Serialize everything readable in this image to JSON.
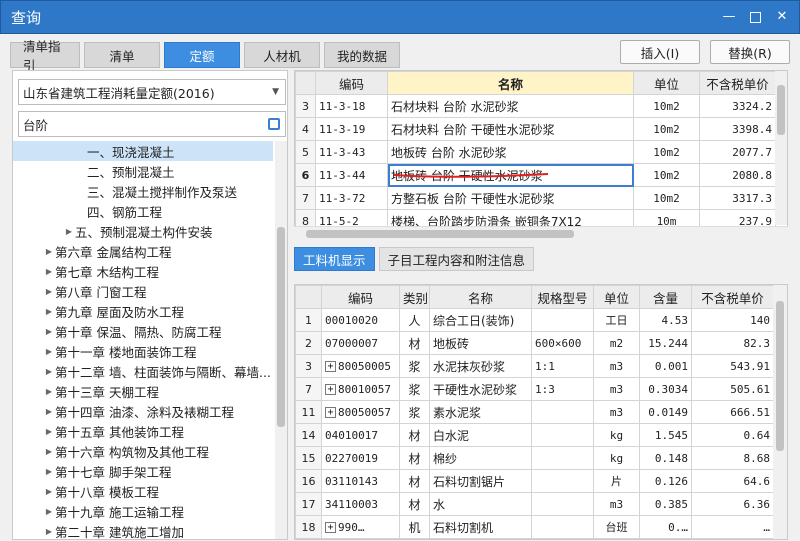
{
  "window": {
    "title": "查询"
  },
  "tabs": [
    "清单指引",
    "清单",
    "定额",
    "人材机",
    "我的数据"
  ],
  "buttons": {
    "insert": "插入(I)",
    "replace": "替换(R)"
  },
  "left": {
    "dropdown": "山东省建筑工程消耗量定额(2016)",
    "search": "台阶",
    "tree": [
      {
        "label": "一、现浇混凝土",
        "indent": 3,
        "selected": true
      },
      {
        "label": "二、预制混凝土",
        "indent": 3
      },
      {
        "label": "三、混凝土搅拌制作及泵送",
        "indent": 3
      },
      {
        "label": "四、钢筋工程",
        "indent": 3
      },
      {
        "label": "五、预制混凝土构件安装",
        "indent": 2,
        "arrow": true
      },
      {
        "label": "第六章 金属结构工程",
        "indent": 1,
        "arrow": true
      },
      {
        "label": "第七章 木结构工程",
        "indent": 1,
        "arrow": true
      },
      {
        "label": "第八章 门窗工程",
        "indent": 1,
        "arrow": true
      },
      {
        "label": "第九章 屋面及防水工程",
        "indent": 1,
        "arrow": true
      },
      {
        "label": "第十章 保温、隔热、防腐工程",
        "indent": 1,
        "arrow": true
      },
      {
        "label": "第十一章 楼地面装饰工程",
        "indent": 1,
        "arrow": true
      },
      {
        "label": "第十二章 墙、柱面装饰与隔断、幕墙...",
        "indent": 1,
        "arrow": true
      },
      {
        "label": "第十三章 天棚工程",
        "indent": 1,
        "arrow": true
      },
      {
        "label": "第十四章 油漆、涂料及裱糊工程",
        "indent": 1,
        "arrow": true
      },
      {
        "label": "第十五章 其他装饰工程",
        "indent": 1,
        "arrow": true
      },
      {
        "label": "第十六章 构筑物及其他工程",
        "indent": 1,
        "arrow": true
      },
      {
        "label": "第十七章 脚手架工程",
        "indent": 1,
        "arrow": true
      },
      {
        "label": "第十八章 模板工程",
        "indent": 1,
        "arrow": true
      },
      {
        "label": "第十九章 施工运输工程",
        "indent": 1,
        "arrow": true
      },
      {
        "label": "第二十章 建筑施工增加",
        "indent": 1,
        "arrow": true
      }
    ]
  },
  "topgrid": {
    "headers": [
      "",
      "编码",
      "名称",
      "单位",
      "不含税单价"
    ],
    "rows": [
      {
        "n": "3",
        "code": "11-3-18",
        "name": "石材块料 台阶 水泥砂浆",
        "unit": "10m2",
        "price": "3324.2"
      },
      {
        "n": "4",
        "code": "11-3-19",
        "name": "石材块料 台阶 干硬性水泥砂浆",
        "unit": "10m2",
        "price": "3398.4"
      },
      {
        "n": "5",
        "code": "11-3-43",
        "name": "地板砖 台阶 水泥砂浆",
        "unit": "10m2",
        "price": "2077.7"
      },
      {
        "n": "6",
        "code": "11-3-44",
        "name": "地板砖 台阶 干硬性水泥砂浆",
        "unit": "10m2",
        "price": "2080.8",
        "current": true
      },
      {
        "n": "7",
        "code": "11-3-72",
        "name": "方整石板 台阶 干硬性水泥砂浆",
        "unit": "10m2",
        "price": "3317.3"
      },
      {
        "n": "8",
        "code": "11-5-2",
        "name": "楼梯、台阶踏步防滑条 嵌铜条7X12",
        "unit": "10m",
        "price": "237.9"
      }
    ]
  },
  "subtabs": [
    "工料机显示",
    "子目工程内容和附注信息"
  ],
  "botgrid": {
    "headers": [
      "",
      "编码",
      "类别",
      "名称",
      "规格型号",
      "单位",
      "含量",
      "不含税单价"
    ],
    "rows": [
      {
        "n": "1",
        "code": "00010020",
        "cat": "人",
        "name": "综合工日(装饰)",
        "spec": "",
        "unit": "工日",
        "qty": "4.53",
        "price": "140"
      },
      {
        "n": "2",
        "code": "07000007",
        "cat": "材",
        "name": "地板砖",
        "spec": "600×600",
        "unit": "m2",
        "qty": "15.244",
        "price": "82.3"
      },
      {
        "n": "3",
        "code": "80050005",
        "cat": "浆",
        "name": "水泥抹灰砂浆",
        "spec": "1:1",
        "unit": "m3",
        "qty": "0.001",
        "price": "543.91",
        "plus": true
      },
      {
        "n": "7",
        "code": "80010057",
        "cat": "浆",
        "name": "干硬性水泥砂浆",
        "spec": "1:3",
        "unit": "m3",
        "qty": "0.3034",
        "price": "505.61",
        "plus": true
      },
      {
        "n": "11",
        "code": "80050057",
        "cat": "浆",
        "name": "素水泥浆",
        "spec": "",
        "unit": "m3",
        "qty": "0.0149",
        "price": "666.51",
        "plus": true
      },
      {
        "n": "14",
        "code": "04010017",
        "cat": "材",
        "name": "白水泥",
        "spec": "",
        "unit": "kg",
        "qty": "1.545",
        "price": "0.64"
      },
      {
        "n": "15",
        "code": "02270019",
        "cat": "材",
        "name": "棉纱",
        "spec": "",
        "unit": "kg",
        "qty": "0.148",
        "price": "8.68"
      },
      {
        "n": "16",
        "code": "03110143",
        "cat": "材",
        "name": "石料切割锯片",
        "spec": "",
        "unit": "片",
        "qty": "0.126",
        "price": "64.6"
      },
      {
        "n": "17",
        "code": "34110003",
        "cat": "材",
        "name": "水",
        "spec": "",
        "unit": "m3",
        "qty": "0.385",
        "price": "6.36"
      },
      {
        "n": "18",
        "code": "990…",
        "cat": "机",
        "name": "石料切割机",
        "spec": "",
        "unit": "台班",
        "qty": "0.…",
        "price": "…",
        "plus": true
      }
    ]
  },
  "colors": {
    "accent": "#3d8ee0",
    "title_bar": "#2f78c7",
    "underline": "#e02020"
  }
}
